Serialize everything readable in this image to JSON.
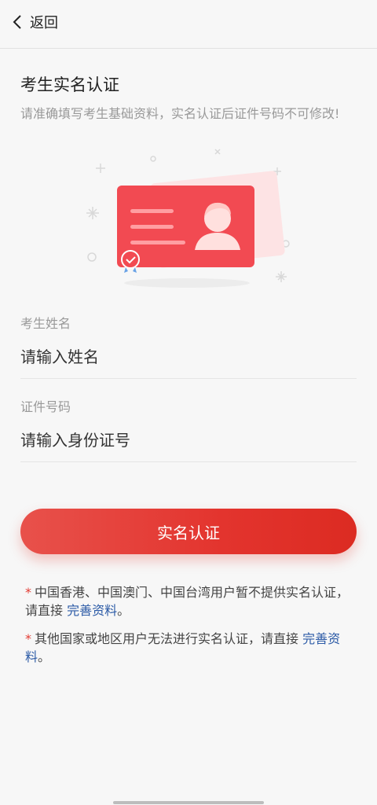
{
  "nav": {
    "back_label": "返回"
  },
  "header": {
    "title": "考生实名认证",
    "subtitle": "请准确填写考生基础资料，实名认证后证件号码不可修改!"
  },
  "form": {
    "name": {
      "label": "考生姓名",
      "placeholder": "请输入姓名",
      "value": ""
    },
    "id_number": {
      "label": "证件号码",
      "placeholder": "请输入身份证号",
      "value": ""
    }
  },
  "submit_label": "实名认证",
  "notes": [
    {
      "star": "*",
      "text": "中国香港、中国澳门、中国台湾用户暂不提供实名认证，请直接 ",
      "link": "完善资料",
      "end": "。"
    },
    {
      "star": "*",
      "text": "其他国家或地区用户无法进行实名认证，请直接 ",
      "link": "完善资料",
      "end": "。"
    }
  ],
  "colors": {
    "accent": "#e3342e",
    "link": "#2b5aa6",
    "card": "#f24a52"
  },
  "icons": {
    "back": "chevron-left-icon",
    "illustration": "id-card-icon",
    "badge": "verified-badge-icon"
  }
}
